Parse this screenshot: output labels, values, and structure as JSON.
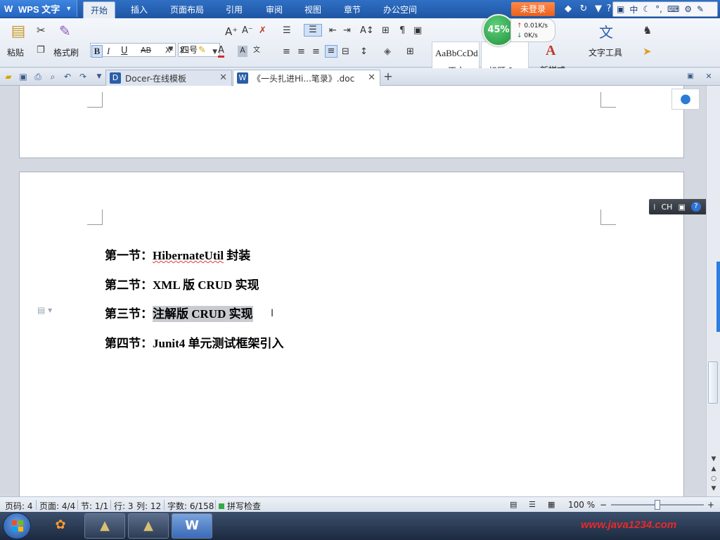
{
  "app": {
    "title": "WPS 文字"
  },
  "menu_tabs": [
    "开始",
    "插入",
    "页面布局",
    "引用",
    "审阅",
    "视图",
    "章节",
    "办公空间"
  ],
  "login_label": "未登录",
  "ime": {
    "lang": "中"
  },
  "ribbon": {
    "paste": "粘贴",
    "format_painter": "格式刷",
    "font_name": "",
    "font_size": "四号",
    "styles": {
      "normal_sample": "AaBbCcDd",
      "normal": "正文",
      "heading1": "标题 1",
      "new_style": "新样式"
    },
    "text_tools": "文字工具"
  },
  "speed": {
    "percent": "45%",
    "up": "0.01K/s",
    "down": "0K/s"
  },
  "tabs": [
    {
      "label": "Docer-在线模板"
    },
    {
      "label": "《一头扎进Hi...笔录》.doc"
    }
  ],
  "document": {
    "lines": [
      {
        "prefix": "第一节：",
        "body": "HibernateUtil",
        "suffix": " 封装"
      },
      {
        "prefix": "第二节：",
        "body": "XML 版 CRUD 实现"
      },
      {
        "prefix": "第三节：",
        "body": "注解版 CRUD 实现"
      },
      {
        "prefix": "第四节：",
        "body": "Junit4 单元测试框架引入"
      }
    ]
  },
  "float_toolbar": {
    "lang": "CH"
  },
  "status": {
    "page_code": "页码: 4",
    "pages": "页面: 4/4",
    "section": "节: 1/1",
    "row": "行: 3",
    "col": "列: 12",
    "word_count": "字数: 6/158",
    "spell": "拼写检查",
    "zoom": "100 %"
  },
  "watermark": "www.java1234.com",
  "colors": {
    "accent": "#2f6fc4",
    "login": "#e8601e",
    "highlight": "#c8cbd0",
    "watermark": "#e62a2a"
  }
}
